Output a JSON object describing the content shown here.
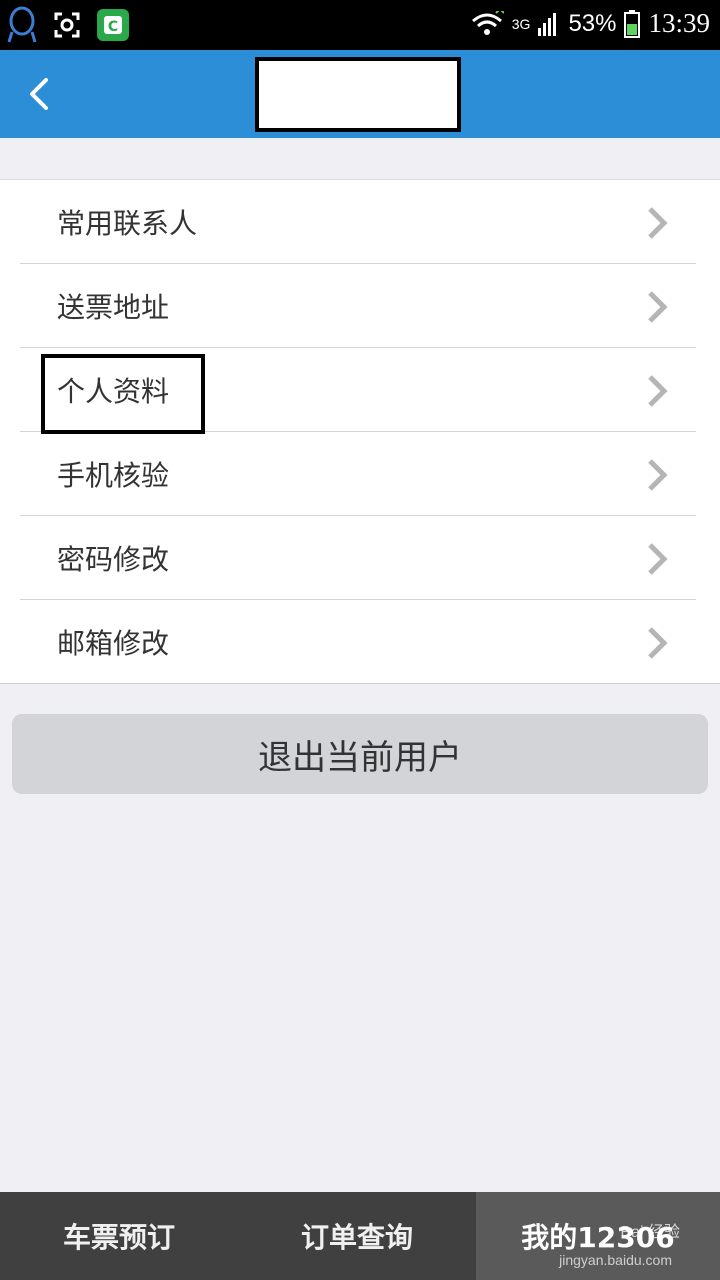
{
  "status_bar": {
    "network": "3G",
    "battery": "53%",
    "time": "13:39"
  },
  "header": {
    "title": ""
  },
  "menu": {
    "items": [
      {
        "label": "常用联系人"
      },
      {
        "label": "送票地址"
      },
      {
        "label": "个人资料"
      },
      {
        "label": "手机核验"
      },
      {
        "label": "密码修改"
      },
      {
        "label": "邮箱修改"
      }
    ]
  },
  "logout_label": "退出当前用户",
  "tabs": [
    {
      "label": "车票预订"
    },
    {
      "label": "订单查询"
    },
    {
      "label": "我的12306"
    }
  ],
  "watermark": {
    "brand": "Bai 经验",
    "url": "jingyan.baidu.com"
  },
  "colors": {
    "header": "#2b8ed6",
    "tab_bar": "#404040",
    "background": "#efeff4"
  }
}
